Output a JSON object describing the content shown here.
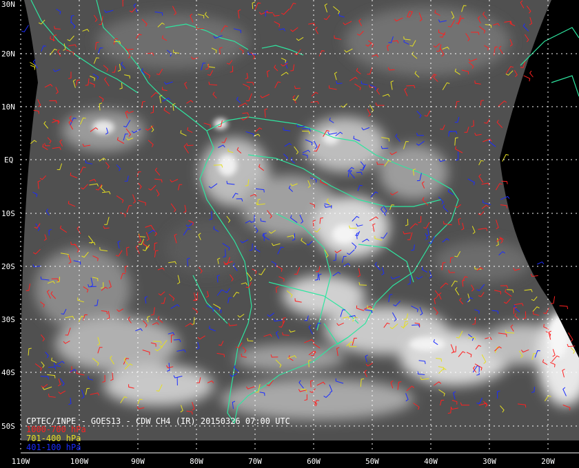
{
  "map": {
    "title": "CPTEC/INPE - GOES13 - CDW CH4 (IR) 20150326 07:00 UTC",
    "legend": [
      {
        "label": "1000-700 hPa",
        "color": "#ff2020"
      },
      {
        "label": "701-400 hPa",
        "color": "#e6e020"
      },
      {
        "label": "401-100 hPa",
        "color": "#1a2cff"
      }
    ],
    "lat_labels": [
      "30N",
      "20N",
      "10N",
      "EQ",
      "10S",
      "20S",
      "30S",
      "40S",
      "50S"
    ],
    "lon_labels": [
      "110W",
      "100W",
      "90W",
      "80W",
      "70W",
      "60W",
      "50W",
      "40W",
      "30W",
      "20W"
    ],
    "colors": {
      "background": "#000000",
      "coastline": "#2ee6a0",
      "grid": "#ffffff",
      "cloud_low": "#4a4a4a",
      "cloud_high": "#e8e8e8"
    }
  }
}
